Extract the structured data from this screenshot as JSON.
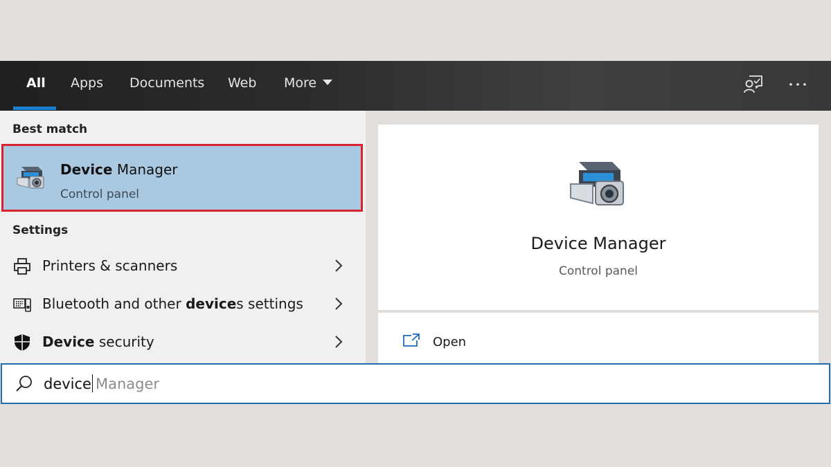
{
  "tabs": [
    {
      "label": "All",
      "active": true
    },
    {
      "label": "Apps"
    },
    {
      "label": "Documents"
    },
    {
      "label": "Web"
    },
    {
      "label": "More"
    }
  ],
  "top_icons": [
    "feedback-icon",
    "more-options-icon"
  ],
  "best_match": {
    "header": "Best match",
    "title_bold": "Device",
    "title_rest": " Manager",
    "subtitle": "Control panel",
    "icon": "device-manager-icon"
  },
  "settings": {
    "header": "Settings",
    "items": [
      {
        "icon": "printer-icon",
        "label_pre": "Printers & scanners",
        "label_bold": "",
        "label_post": ""
      },
      {
        "icon": "keyboard-speaker-icon",
        "label_pre": "Bluetooth and other ",
        "label_bold": "device",
        "label_post": "s settings"
      },
      {
        "icon": "shield-icon",
        "label_pre": "",
        "label_bold": "Device",
        "label_post": " security"
      }
    ]
  },
  "detail": {
    "title": "Device Manager",
    "subtitle": "Control panel",
    "actions": [
      {
        "label": "Open",
        "icon": "open-window-icon"
      }
    ]
  },
  "search": {
    "typed": "device",
    "suggestion": "Manager"
  },
  "colors": {
    "accent": "#1a80d0",
    "selection": "#a9c9e3",
    "highlight_border": "#d8232a"
  }
}
